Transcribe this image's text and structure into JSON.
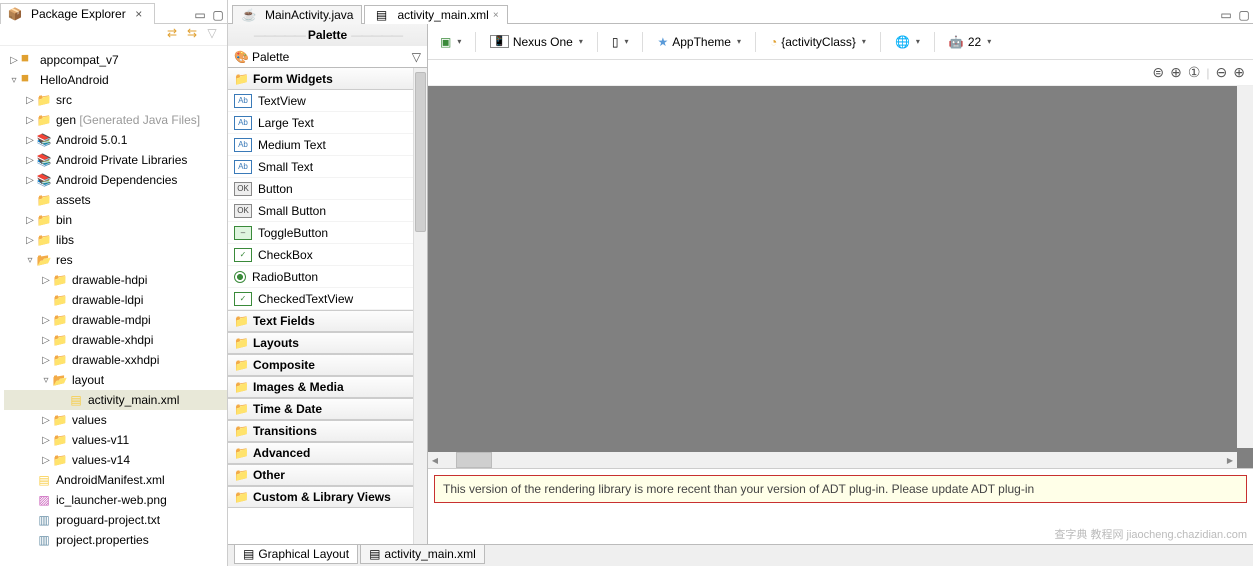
{
  "explorer": {
    "title": "Package Explorer",
    "tree": [
      {
        "d": 0,
        "exp": "▷",
        "icon": "proj",
        "label": "appcompat_v7"
      },
      {
        "d": 0,
        "exp": "▿",
        "icon": "proj",
        "label": "HelloAndroid"
      },
      {
        "d": 1,
        "exp": "▷",
        "icon": "pkg-folder",
        "label": "src"
      },
      {
        "d": 1,
        "exp": "▷",
        "icon": "pkg-folder",
        "label": "gen",
        "annot": "[Generated Java Files]"
      },
      {
        "d": 1,
        "exp": "▷",
        "icon": "lib",
        "label": "Android 5.0.1"
      },
      {
        "d": 1,
        "exp": "▷",
        "icon": "lib",
        "label": "Android Private Libraries"
      },
      {
        "d": 1,
        "exp": "▷",
        "icon": "lib",
        "label": "Android Dependencies"
      },
      {
        "d": 1,
        "exp": "",
        "icon": "folder",
        "label": "assets"
      },
      {
        "d": 1,
        "exp": "▷",
        "icon": "folder",
        "label": "bin"
      },
      {
        "d": 1,
        "exp": "▷",
        "icon": "folder",
        "label": "libs"
      },
      {
        "d": 1,
        "exp": "▿",
        "icon": "open-folder",
        "label": "res"
      },
      {
        "d": 2,
        "exp": "▷",
        "icon": "folder",
        "label": "drawable-hdpi"
      },
      {
        "d": 2,
        "exp": "",
        "icon": "folder",
        "label": "drawable-ldpi"
      },
      {
        "d": 2,
        "exp": "▷",
        "icon": "folder",
        "label": "drawable-mdpi"
      },
      {
        "d": 2,
        "exp": "▷",
        "icon": "folder",
        "label": "drawable-xhdpi"
      },
      {
        "d": 2,
        "exp": "▷",
        "icon": "folder",
        "label": "drawable-xxhdpi"
      },
      {
        "d": 2,
        "exp": "▿",
        "icon": "open-folder",
        "label": "layout"
      },
      {
        "d": 3,
        "exp": "",
        "icon": "xml",
        "label": "activity_main.xml",
        "sel": true
      },
      {
        "d": 2,
        "exp": "▷",
        "icon": "folder",
        "label": "values"
      },
      {
        "d": 2,
        "exp": "▷",
        "icon": "folder",
        "label": "values-v11"
      },
      {
        "d": 2,
        "exp": "▷",
        "icon": "folder",
        "label": "values-v14"
      },
      {
        "d": 1,
        "exp": "",
        "icon": "xml",
        "label": "AndroidManifest.xml"
      },
      {
        "d": 1,
        "exp": "",
        "icon": "png",
        "label": "ic_launcher-web.png"
      },
      {
        "d": 1,
        "exp": "",
        "icon": "txt",
        "label": "proguard-project.txt"
      },
      {
        "d": 1,
        "exp": "",
        "icon": "txt",
        "label": "project.properties"
      }
    ]
  },
  "editor": {
    "tabs": [
      {
        "label": "MainActivity.java",
        "active": false,
        "icon": "java"
      },
      {
        "label": "activity_main.xml",
        "active": true,
        "icon": "xml"
      }
    ],
    "bottom_tabs": [
      {
        "label": "Graphical Layout",
        "active": true
      },
      {
        "label": "activity_main.xml",
        "active": false
      }
    ]
  },
  "palette": {
    "header": "Palette",
    "combo": "Palette",
    "groups": [
      {
        "cat": "Form Widgets",
        "open": true,
        "items": [
          {
            "w": "ab",
            "label": "TextView",
            "code": "Ab"
          },
          {
            "w": "ab",
            "label": "Large Text",
            "code": "Ab"
          },
          {
            "w": "ab",
            "label": "Medium Text",
            "code": "Ab"
          },
          {
            "w": "ab",
            "label": "Small Text",
            "code": "Ab"
          },
          {
            "w": "ok",
            "label": "Button",
            "code": "OK"
          },
          {
            "w": "ok",
            "label": "Small Button",
            "code": "OK"
          },
          {
            "w": "tg",
            "label": "ToggleButton",
            "code": "–"
          },
          {
            "w": "cb",
            "label": "CheckBox",
            "code": "✓"
          },
          {
            "w": "rb",
            "label": "RadioButton",
            "code": ""
          },
          {
            "w": "cb",
            "label": "CheckedTextView",
            "code": "✓"
          }
        ]
      },
      {
        "cat": "Text Fields"
      },
      {
        "cat": "Layouts"
      },
      {
        "cat": "Composite"
      },
      {
        "cat": "Images & Media"
      },
      {
        "cat": "Time & Date"
      },
      {
        "cat": "Transitions"
      },
      {
        "cat": "Advanced"
      },
      {
        "cat": "Other"
      },
      {
        "cat": "Custom & Library Views"
      }
    ]
  },
  "toolbar": {
    "device": "Nexus One",
    "theme": "AppTheme",
    "activity": "{activityClass}",
    "api": "22"
  },
  "error": "This version of the rendering library is more recent than your version of ADT plug-in. Please update ADT plug-in",
  "watermark": "查字典 教程网\njiaocheng.chazidian.com"
}
